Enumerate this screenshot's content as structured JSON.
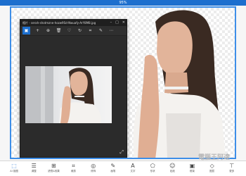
{
  "app": {
    "zoom_label": "95%"
  },
  "viewer": {
    "title": "相片 - serah-shotmzne-hozw9Sd-Nwuafy-ArY8M8.jpg",
    "window_buttons": [
      "–",
      "□",
      "✕"
    ],
    "toolbar_icons": [
      "image-icon",
      "add-icon",
      "zoom-in-icon",
      "delete-icon",
      "heart-icon",
      "rotate-icon",
      "crop-icon",
      "edit-icon",
      "more-icon"
    ]
  },
  "toolbar": {
    "tools": [
      {
        "icon": "ai-select-icon",
        "label": "AI 抠图",
        "active": true
      },
      {
        "icon": "adjust-icon",
        "label": "调整"
      },
      {
        "icon": "filter-icon",
        "label": "滤镜&效果"
      },
      {
        "icon": "crop-icon",
        "label": "裁剪"
      },
      {
        "icon": "retouch-icon",
        "label": "修饰"
      },
      {
        "icon": "draw-icon",
        "label": "画笔"
      },
      {
        "icon": "text-icon",
        "label": "文字"
      },
      {
        "icon": "shape-icon",
        "label": "形状"
      },
      {
        "icon": "sticker-icon",
        "label": "贴纸"
      },
      {
        "icon": "frame-icon",
        "label": "框架"
      },
      {
        "icon": "layer-icon",
        "label": "图层"
      },
      {
        "icon": "more-tools-icon",
        "label": "更多"
      }
    ]
  },
  "watermark": {
    "text": "電腦王阿達",
    "url": "http://www.kocpc.com.tw"
  }
}
